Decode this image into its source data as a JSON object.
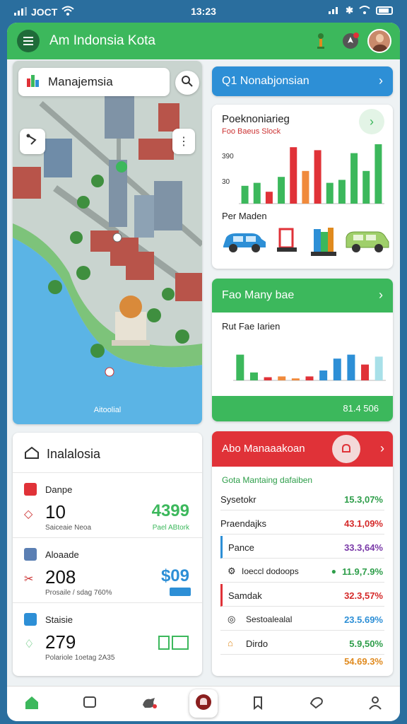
{
  "status": {
    "carrier": "JOCT",
    "time": "13:23"
  },
  "appbar": {
    "title": "Am Indonsia Kota"
  },
  "map": {
    "search_label": "Manajemsia",
    "caption": "Aitoolial"
  },
  "blue_header": {
    "label": "Q1 Nonabjonsian"
  },
  "chart1": {
    "title": "Poeknoniarieg",
    "subtitle": "Foo Baeus Slock",
    "vehicles_label": "Per Maden"
  },
  "chart2": {
    "header": "Fao Many bae",
    "label": "Rut Fae Iarien",
    "footer": "81.4 506"
  },
  "stats": {
    "title": "Inalalosia",
    "items": [
      {
        "label": "Danpe",
        "number": "10",
        "sub": "Saiceaie Neoa",
        "value": "4399",
        "value_sub": "Pael ABtork",
        "value_color": "#3cb85c"
      },
      {
        "label": "Aloaade",
        "number": "208",
        "sub": "Prosaile / sdag 760%",
        "value": "$09",
        "value_sub": "",
        "value_color": "#2d8fd6"
      },
      {
        "label": "Staisie",
        "number": "279",
        "sub": "Polariole 1oetag 2A35",
        "value": "",
        "value_sub": "",
        "value_color": "#3cb85c"
      }
    ]
  },
  "list": {
    "header": "Abo Manaaakoan",
    "subtitle": "Gota Mantaing dafaiben",
    "rows": [
      {
        "label": "Sysetokr",
        "value": "15.3,07%",
        "color": "#2e9e4a"
      },
      {
        "label": "Praendajks",
        "value": "43.1,09%",
        "color": "#d52a2a"
      },
      {
        "label": "Pance",
        "value": "33.3,64%",
        "color": "#7a3aa8"
      },
      {
        "label": "Ioeccl dodoops",
        "value": "11.9,7.9%",
        "color": "#2e9e4a"
      },
      {
        "label": "Samdak",
        "value": "32.3,57%",
        "color": "#d52a2a"
      },
      {
        "label": "Sestoalealal",
        "value": "23.5.69%",
        "color": "#2d8fd6"
      },
      {
        "label": "Dirdo",
        "value": "5.9,50%",
        "color": "#2e9e4a"
      },
      {
        "label": "",
        "value": "54.69.3%",
        "color": "#e08a1e"
      }
    ]
  },
  "chart1_data": {
    "type": "bar",
    "title": "Poeknoniarieg",
    "ytick_labels": [
      "390",
      "30"
    ],
    "values": [
      30,
      35,
      20,
      45,
      95,
      55,
      90,
      35,
      40,
      85,
      55,
      100
    ],
    "ylim": [
      0,
      100
    ],
    "colors": [
      "#3cb85c",
      "#3cb85c",
      "#e03238",
      "#3cb85c",
      "#e03238",
      "#f08a3c",
      "#e03238",
      "#3cb85c",
      "#3cb85c",
      "#3cb85c",
      "#3cb85c",
      "#3cb85c"
    ]
  },
  "chart_data": {
    "type": "bar",
    "title": "Rut Fae Iarien",
    "values": [
      65,
      20,
      8,
      10,
      5,
      10,
      25,
      55,
      65,
      40,
      60
    ],
    "ylim": [
      0,
      100
    ],
    "colors": [
      "#3cb85c",
      "#3cb85c",
      "#e03238",
      "#f08a3c",
      "#f08a3c",
      "#e03238",
      "#2d8fd6",
      "#2d8fd6",
      "#2d8fd6",
      "#e03238",
      "#a8e0e8"
    ]
  }
}
